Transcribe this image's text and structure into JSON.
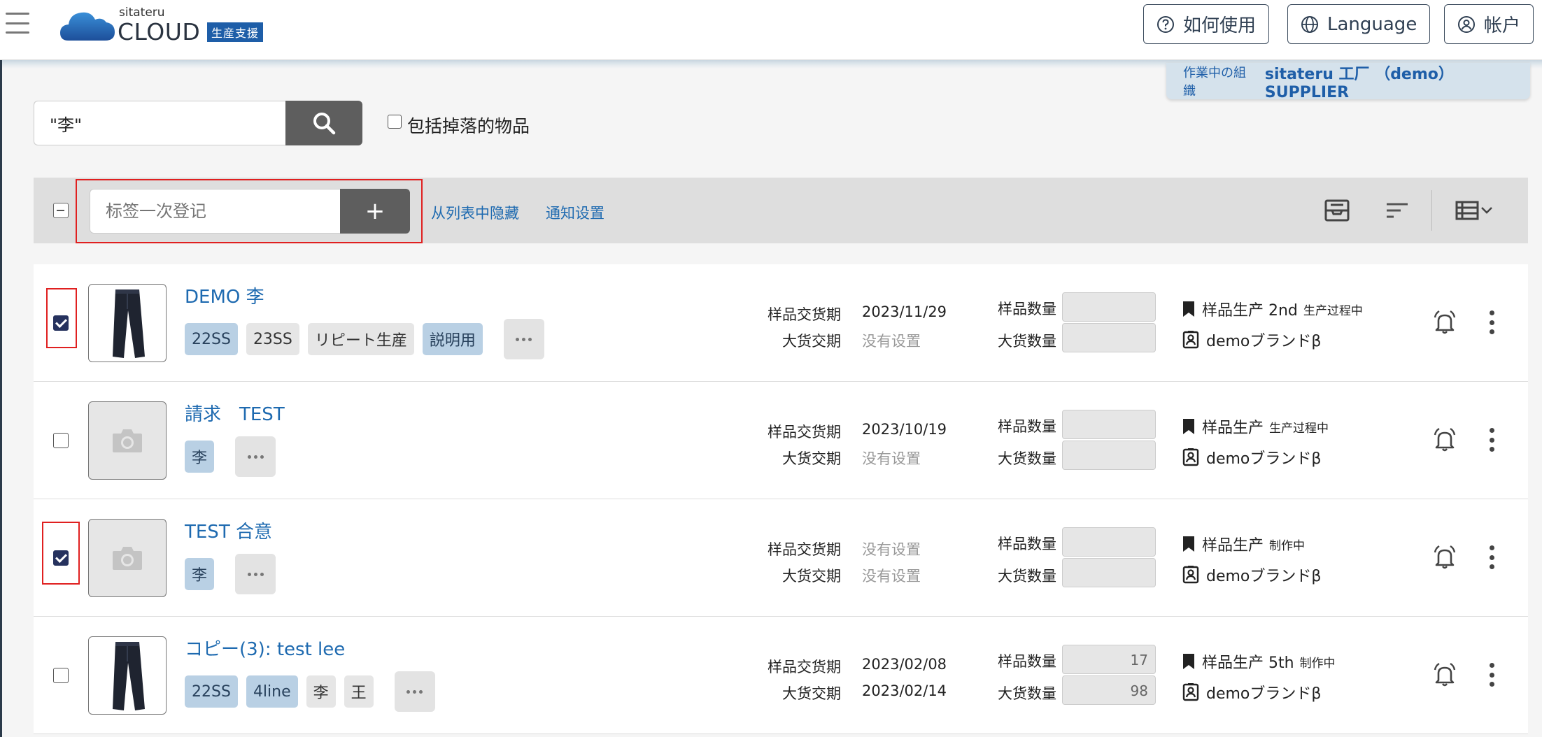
{
  "header": {
    "logo_small": "sitateru",
    "logo_big": "CLOUD",
    "logo_tag": "生産支援",
    "help_label": "如何使用",
    "language_label": "Language",
    "account_label": "帐户"
  },
  "org": {
    "label": "作業中の組織",
    "name": "sitateru 工厂 （demo） SUPPLIER"
  },
  "search": {
    "value": "\"李\"",
    "include_label": "包括掉落的物品",
    "include_checked": false
  },
  "toolbar": {
    "tag_placeholder": "标签一次登记",
    "add_label": "+",
    "hide_link": "从列表中隐藏",
    "notify_link": "通知设置"
  },
  "labels": {
    "sample_date": "样品交货期",
    "bulk_date": "大货交期",
    "sample_qty": "样品数量",
    "bulk_qty": "大货数量"
  },
  "rows": [
    {
      "title": "DEMO 李",
      "checked": true,
      "thumb": "pants",
      "tags": [
        {
          "text": "22SS",
          "style": "blue"
        },
        {
          "text": "23SS",
          "style": "gray"
        },
        {
          "text": "リピート生産",
          "style": "gray"
        },
        {
          "text": "説明用",
          "style": "blue"
        }
      ],
      "sample_date": "2023/11/29",
      "bulk_date": "没有设置",
      "sample_qty": "",
      "bulk_qty": "",
      "production": "样品生产 2nd",
      "production_status": "生产过程中",
      "brand": "demoブランドβ"
    },
    {
      "title": "請求　TEST",
      "checked": false,
      "thumb": "camera",
      "tags": [
        {
          "text": "李",
          "style": "blue"
        }
      ],
      "sample_date": "2023/10/19",
      "bulk_date": "没有设置",
      "sample_qty": "",
      "bulk_qty": "",
      "production": "样品生产",
      "production_status": "生产过程中",
      "brand": "demoブランドβ"
    },
    {
      "title": "TEST 合意",
      "checked": true,
      "thumb": "camera",
      "tags": [
        {
          "text": "李",
          "style": "blue"
        }
      ],
      "sample_date": "没有设置",
      "bulk_date": "没有设置",
      "sample_qty": "",
      "bulk_qty": "",
      "production": "样品生产",
      "production_status": "制作中",
      "brand": "demoブランドβ"
    },
    {
      "title": "コピー(3): test lee",
      "checked": false,
      "thumb": "pants",
      "tags": [
        {
          "text": "22SS",
          "style": "blue"
        },
        {
          "text": "4line",
          "style": "blue"
        },
        {
          "text": "李",
          "style": "gray"
        },
        {
          "text": "王",
          "style": "gray"
        }
      ],
      "sample_date": "2023/02/08",
      "bulk_date": "2023/02/14",
      "sample_qty": "17",
      "bulk_qty": "98",
      "production": "样品生产 5th",
      "production_status": "制作中",
      "brand": "demoブランドβ"
    }
  ]
}
